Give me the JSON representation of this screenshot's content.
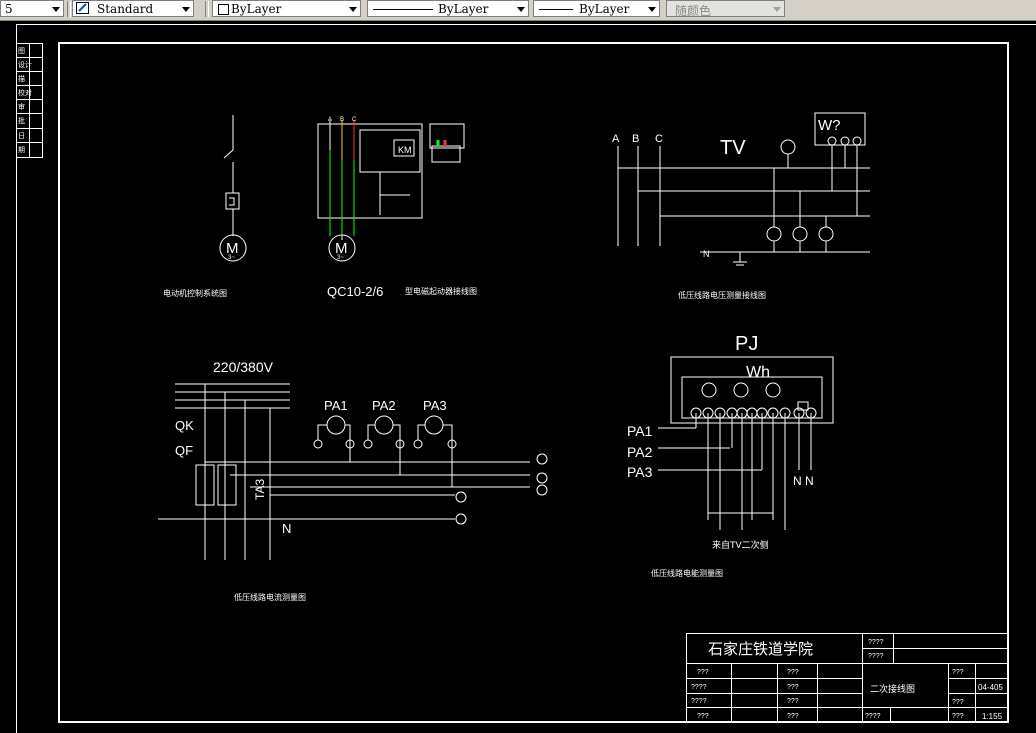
{
  "toolbar": {
    "layer_value": "5",
    "text_style": "Standard",
    "color": "ByLayer",
    "linetype": "ByLayer",
    "lineweight": "ByLayer",
    "plot_style": "随颜色"
  },
  "side_table": {
    "rows": [
      "图",
      "设计",
      "描",
      "校对",
      "审",
      "批",
      "日",
      "期"
    ]
  },
  "diagram": {
    "motor_system_caption": "电动机控制系统图",
    "qc_title": "QC10-2/6",
    "qc_caption": "型电磁起动器接线图",
    "phase_a": "A",
    "phase_b": "B",
    "phase_c": "C",
    "tv_label": "TV",
    "w_label": "W?",
    "n_label": "N",
    "voltage_caption": "低压线路电压测量接线图",
    "voltage_220": "220/380V",
    "qk": "QK",
    "qf": "QF",
    "pa1": "PA1",
    "pa2": "PA2",
    "pa3": "PA3",
    "ta_label": "TA3",
    "current_caption": "低压线路电流测量图",
    "pj": "PJ",
    "wh": "Wh",
    "nn": "N N",
    "from_tv": "来自TV二次侧",
    "energy_caption": "低压线路电能测量图",
    "motor_m": "M",
    "motor_3": "3~"
  },
  "title_block": {
    "school": "石家庄铁道学院",
    "drawing_name": "二次接线图",
    "drawing_no": "04-405",
    "scale": "1:155",
    "unknown": "???",
    "unknown4": "????"
  }
}
